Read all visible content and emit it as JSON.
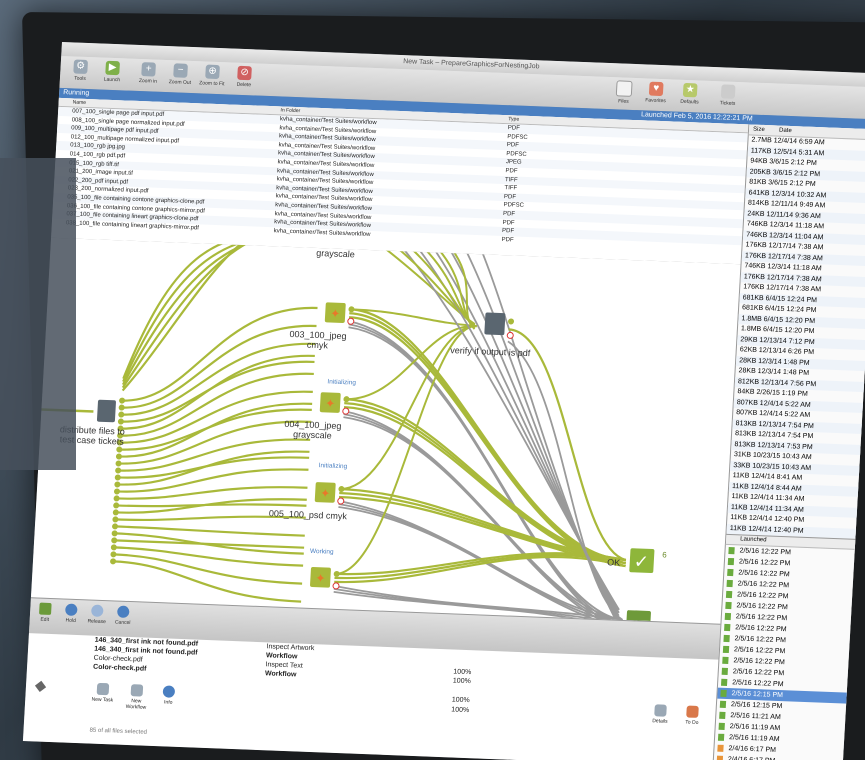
{
  "window": {
    "title": "New Task – PrepareGraphicsForNestingJob"
  },
  "toolbar": {
    "buttons": [
      "Tools",
      "Launch",
      "Zoom in",
      "Zoom Out",
      "Zoom to Fit",
      "Delete"
    ],
    "right_buttons": [
      "Files",
      "Favorites",
      "Defaults",
      "Tickets"
    ]
  },
  "status": {
    "running": "Running",
    "launched": "Launched Feb 5, 2016 12:22:21 PM"
  },
  "files": {
    "headers": [
      "Name",
      "In Folder",
      "Type"
    ],
    "rows": [
      [
        "007_100_single page pdf input.pdf",
        "kvha_container/Test Suites/workflow",
        "PDF"
      ],
      [
        "008_100_single page normalized input.pdf",
        "kvha_container/Test Suites/workflow",
        "PDFSC"
      ],
      [
        "009_100_multipage pdf input.pdf",
        "kvha_container/Test Suites/workflow",
        "PDF"
      ],
      [
        "012_100_multipage normalized input.pdf",
        "kvha_container/Test Suites/workflow",
        "PDFSC"
      ],
      [
        "013_100_rgb jpg.jpg",
        "kvha_container/Test Suites/workflow",
        "JPEG"
      ],
      [
        "014_100_rgb pdf.pdf",
        "kvha_container/Test Suites/workflow",
        "PDF"
      ],
      [
        "015_100_rgb tiff.tif",
        "kvha_container/Test Suites/workflow",
        "TIFF"
      ],
      [
        "021_200_image input.tif",
        "kvha_container/Test Suites/workflow",
        "TIFF"
      ],
      [
        "022_200_pdf input.pdf",
        "kvha_container/Test Suites/workflow",
        "PDF"
      ],
      [
        "023_200_normalized input.pdf",
        "kvha_container/Test Suites/workflow",
        "PDFSC"
      ],
      [
        "035_100_file containing contone graphics-clone.pdf",
        "kvha_container/Test Suites/workflow",
        "PDF"
      ],
      [
        "036_100_file containing contone graphics-mirror.pdf",
        "kvha_container/Test Suites/workflow",
        "PDF"
      ],
      [
        "037_100_file containing lineart graphics-clone.pdf",
        "kvha_container/Test Suites/workflow",
        "PDF"
      ],
      [
        "038_100_file containing lineart graphics-mirror.pdf",
        "kvha_container/Test Suites/workflow",
        "PDF"
      ]
    ]
  },
  "side": {
    "headers": [
      "Size",
      "Date"
    ],
    "rows": [
      "2.7MB 12/4/14 6:59 AM",
      "117KB 12/5/14 5:31 AM",
      "94KB 3/6/15 2:12 PM",
      "205KB 3/6/15 2:12 PM",
      "81KB 3/6/15 2:12 PM",
      "641KB 12/3/14 10:32 AM",
      "814KB 12/11/14 9:49 AM",
      "24KB 12/11/14 9:36 AM",
      "746KB 12/3/14 11:18 AM",
      "746KB 12/3/14 11:04 AM",
      "176KB 12/17/14 7:38 AM",
      "176KB 12/17/14 7:38 AM",
      "746KB 12/3/14 11:18 AM",
      "176KB 12/17/14 7:38 AM",
      "176KB 12/17/14 7:38 AM",
      "681KB 6/4/15 12:24 PM",
      "681KB 6/4/15 12:24 PM",
      "1.8MB 6/4/15 12:20 PM",
      "1.8MB 6/4/15 12:20 PM",
      "29KB 12/13/14 7:12 PM",
      "62KB 12/13/14 6:26 PM",
      "28KB 12/3/14 1:48 PM",
      "28KB 12/3/14 1:48 PM",
      "812KB 12/13/14 7:56 PM",
      "84KB 2/26/15 1:19 PM",
      "807KB 12/4/14 5:22 AM",
      "807KB 12/4/14 5:22 AM",
      "813KB 12/13/14 7:54 PM",
      "813KB 12/13/14 7:54 PM",
      "813KB 12/13/14 7:53 PM",
      "31KB 10/23/15 10:43 AM",
      "33KB 10/23/15 10:43 AM",
      "11KB 12/4/14 8:41 AM",
      "11KB 12/4/14 8:44 AM",
      "11KB 12/4/14 11:34 AM",
      "11KB 12/4/14 11:34 AM",
      "11KB 12/4/14 12:40 PM",
      "11KB 12/4/14 12:40 PM"
    ],
    "launched_header": "Launched",
    "launched_rows": [
      "2/5/16 12:22 PM",
      "2/5/16 12:22 PM",
      "2/5/16 12:22 PM",
      "2/5/16 12:22 PM",
      "2/5/16 12:22 PM",
      "2/5/16 12:22 PM",
      "2/5/16 12:22 PM",
      "2/5/16 12:22 PM",
      "2/5/16 12:22 PM",
      "2/5/16 12:22 PM",
      "2/5/16 12:22 PM",
      "2/5/16 12:22 PM",
      "2/5/16 12:22 PM",
      "2/5/16 12:15 PM",
      "2/5/16 12:15 PM",
      "2/5/16 11:21 AM",
      "2/5/16 11:19 AM",
      "2/5/16 11:19 AM",
      "2/4/16 6:17 PM",
      "2/4/16 6:17 PM"
    ]
  },
  "workflow": {
    "nodes": {
      "distribute": "distribute files to test case tickets",
      "jpeg_cmyk": "003_100_jpeg cmyk",
      "jpeg_gray": "004_100_jpeg grayscale",
      "psd_cmyk": "005_100_psd cmyk",
      "verify": "verify if output is pdf",
      "ok": "OK",
      "grayscale_top": "grayscale"
    },
    "status": {
      "init1": "Initializing",
      "init2": "Initializing",
      "working": "Working"
    },
    "badge": "6"
  },
  "actionbar": {
    "buttons": [
      "Edit",
      "Hold",
      "Release",
      "Cancel"
    ]
  },
  "bottom": {
    "rows": [
      [
        "146_340_first ink not found.pdf",
        "Inspect Artwork",
        ""
      ],
      [
        "146_340_first ink not found.pdf",
        "Workflow",
        ""
      ],
      [
        "Color-check.pdf",
        "Inspect Text",
        "100%"
      ],
      [
        "Color-check.pdf",
        "Workflow",
        "100%"
      ]
    ],
    "tools": [
      "New Task",
      "New Workflow",
      "Info"
    ],
    "right_tools": [
      "Details",
      "To Do"
    ],
    "percent_rows": [
      "100%",
      "100%"
    ],
    "footer": "85 of all files selected"
  }
}
